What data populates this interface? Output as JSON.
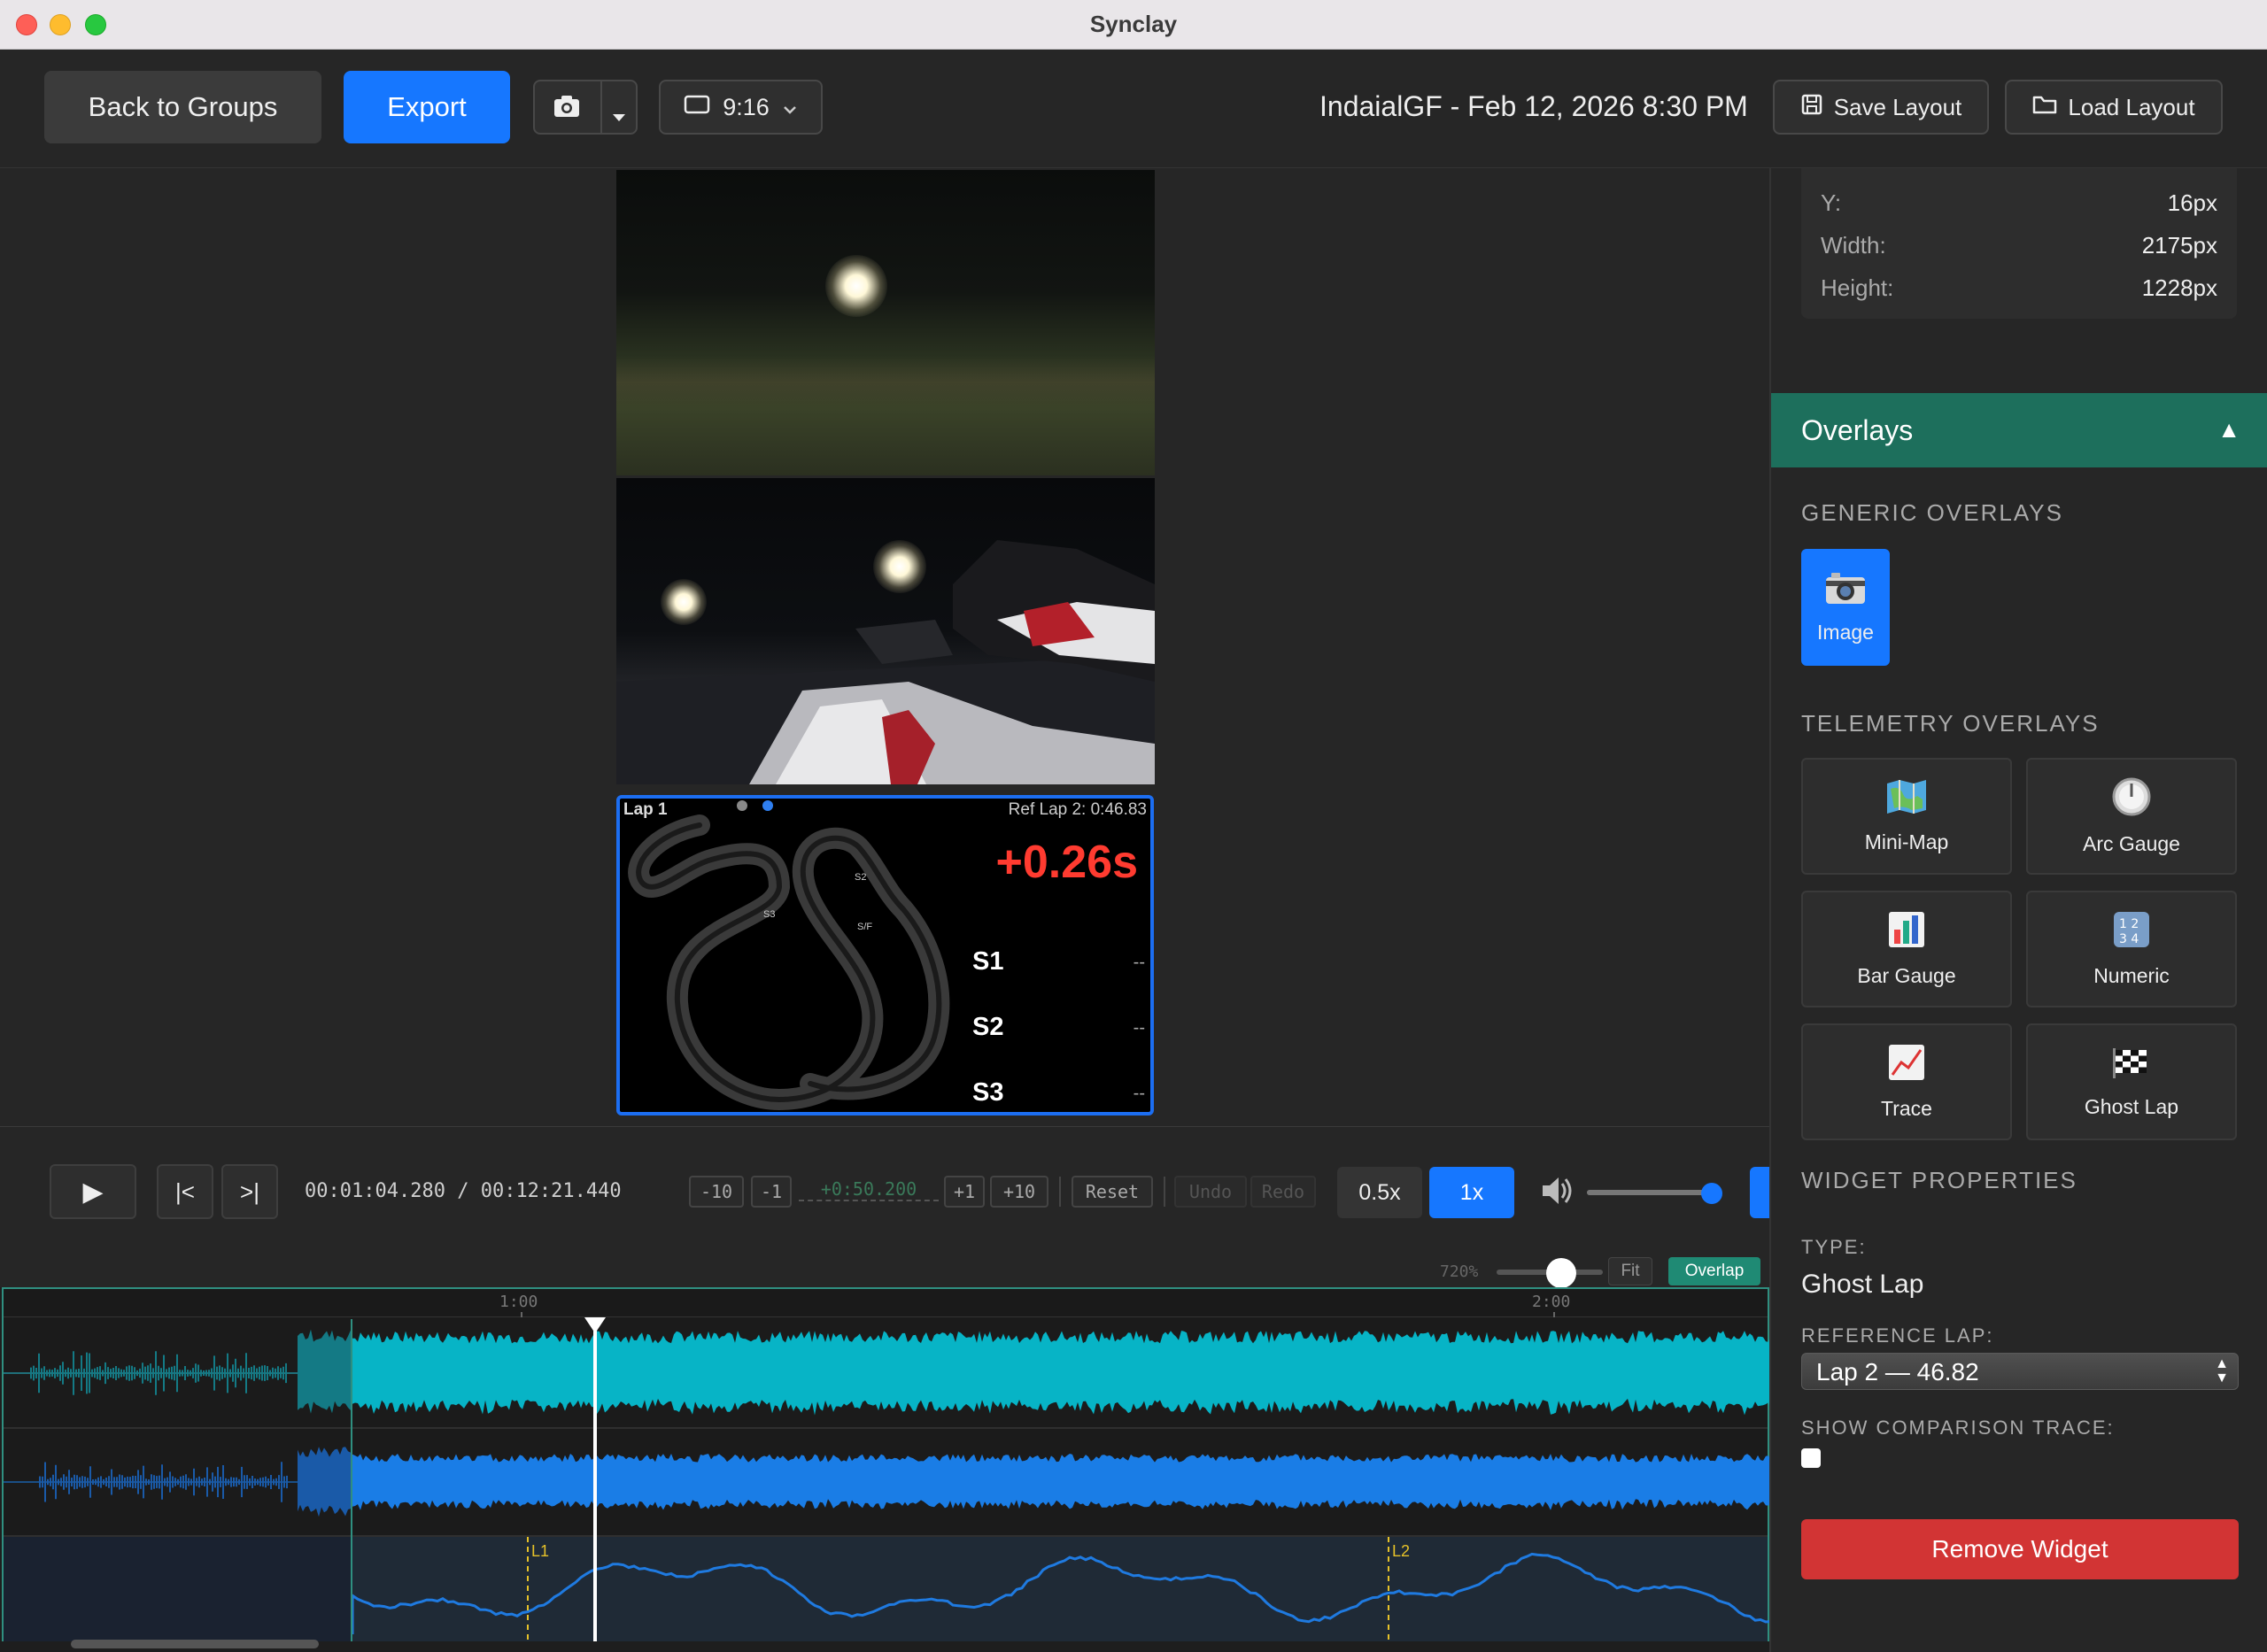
{
  "window": {
    "title": "Synclay"
  },
  "toolbar": {
    "back_label": "Back to Groups",
    "export_label": "Export",
    "aspect_label": "9:16",
    "session_title": "IndaialGF - Feb 12, 2026 8:30 PM",
    "save_layout_label": "Save Layout",
    "load_layout_label": "Load Layout"
  },
  "ghost_widget": {
    "lap_label": "Lap 1",
    "ref_label": "Ref Lap 2: 0:46.83",
    "delta": "+0.26s",
    "track_labels": [
      "S2",
      "S3",
      "S/F"
    ],
    "sectors": [
      {
        "name": "S1",
        "value": "--"
      },
      {
        "name": "S2",
        "value": "--"
      },
      {
        "name": "S3",
        "value": "--"
      }
    ]
  },
  "transport": {
    "play_icon": "▶",
    "skip_back": "|<",
    "skip_forward": ">|",
    "current_time": "00:01:04.280",
    "separator": "/",
    "total_time": "00:12:21.440",
    "nudge_minus10": "-10",
    "nudge_minus1": "-1",
    "offset": "+0:50.200",
    "nudge_plus1": "+1",
    "nudge_plus10": "+10",
    "reset": "Reset",
    "undo": "Undo",
    "redo": "Redo",
    "speed_half": "0.5x",
    "speed_one": "1x",
    "active_speed": "1x",
    "volume": 0.94
  },
  "zoom": {
    "level": "720%",
    "fit_label": "Fit",
    "overlap_label": "Overlap"
  },
  "timeline": {
    "ruler_labels": [
      "1:00",
      "2:00"
    ],
    "lap_markers": [
      "L1",
      "L2"
    ],
    "colors": {
      "track1": "#07b4c6",
      "track2": "#1a7de6",
      "trace": "#1f7ae0",
      "lap_marker": "#e6c229",
      "border": "#2f8f80"
    }
  },
  "panel": {
    "position": [
      {
        "key": "Y:",
        "value": "16px"
      },
      {
        "key": "Width:",
        "value": "2175px"
      },
      {
        "key": "Height:",
        "value": "1228px"
      }
    ],
    "overlays_title": "Overlays",
    "generic_title": "GENERIC OVERLAYS",
    "generic_items": [
      {
        "label": "Image",
        "icon": "camera-icon"
      }
    ],
    "telemetry_title": "TELEMETRY OVERLAYS",
    "telemetry_items": [
      {
        "label": "Mini-Map",
        "icon": "map-icon"
      },
      {
        "label": "Arc Gauge",
        "icon": "gauge-icon"
      },
      {
        "label": "Bar Gauge",
        "icon": "bar-chart-icon"
      },
      {
        "label": "Numeric",
        "icon": "numeric-icon"
      },
      {
        "label": "Trace",
        "icon": "line-chart-icon"
      },
      {
        "label": "Ghost Lap",
        "icon": "checkered-flag-icon"
      }
    ],
    "widget_props_title": "WIDGET PROPERTIES",
    "type_label": "TYPE:",
    "type_value": "Ghost Lap",
    "ref_lap_label": "REFERENCE LAP:",
    "ref_lap_value": "Lap 2 — 46.82",
    "show_trace_label": "SHOW COMPARISON TRACE:",
    "show_trace_checked": false,
    "remove_label": "Remove Widget"
  },
  "colors": {
    "accent": "#1677ff",
    "overlays_header": "#1d6f5c",
    "danger": "#d23434",
    "delta_red": "#ff3b30"
  }
}
